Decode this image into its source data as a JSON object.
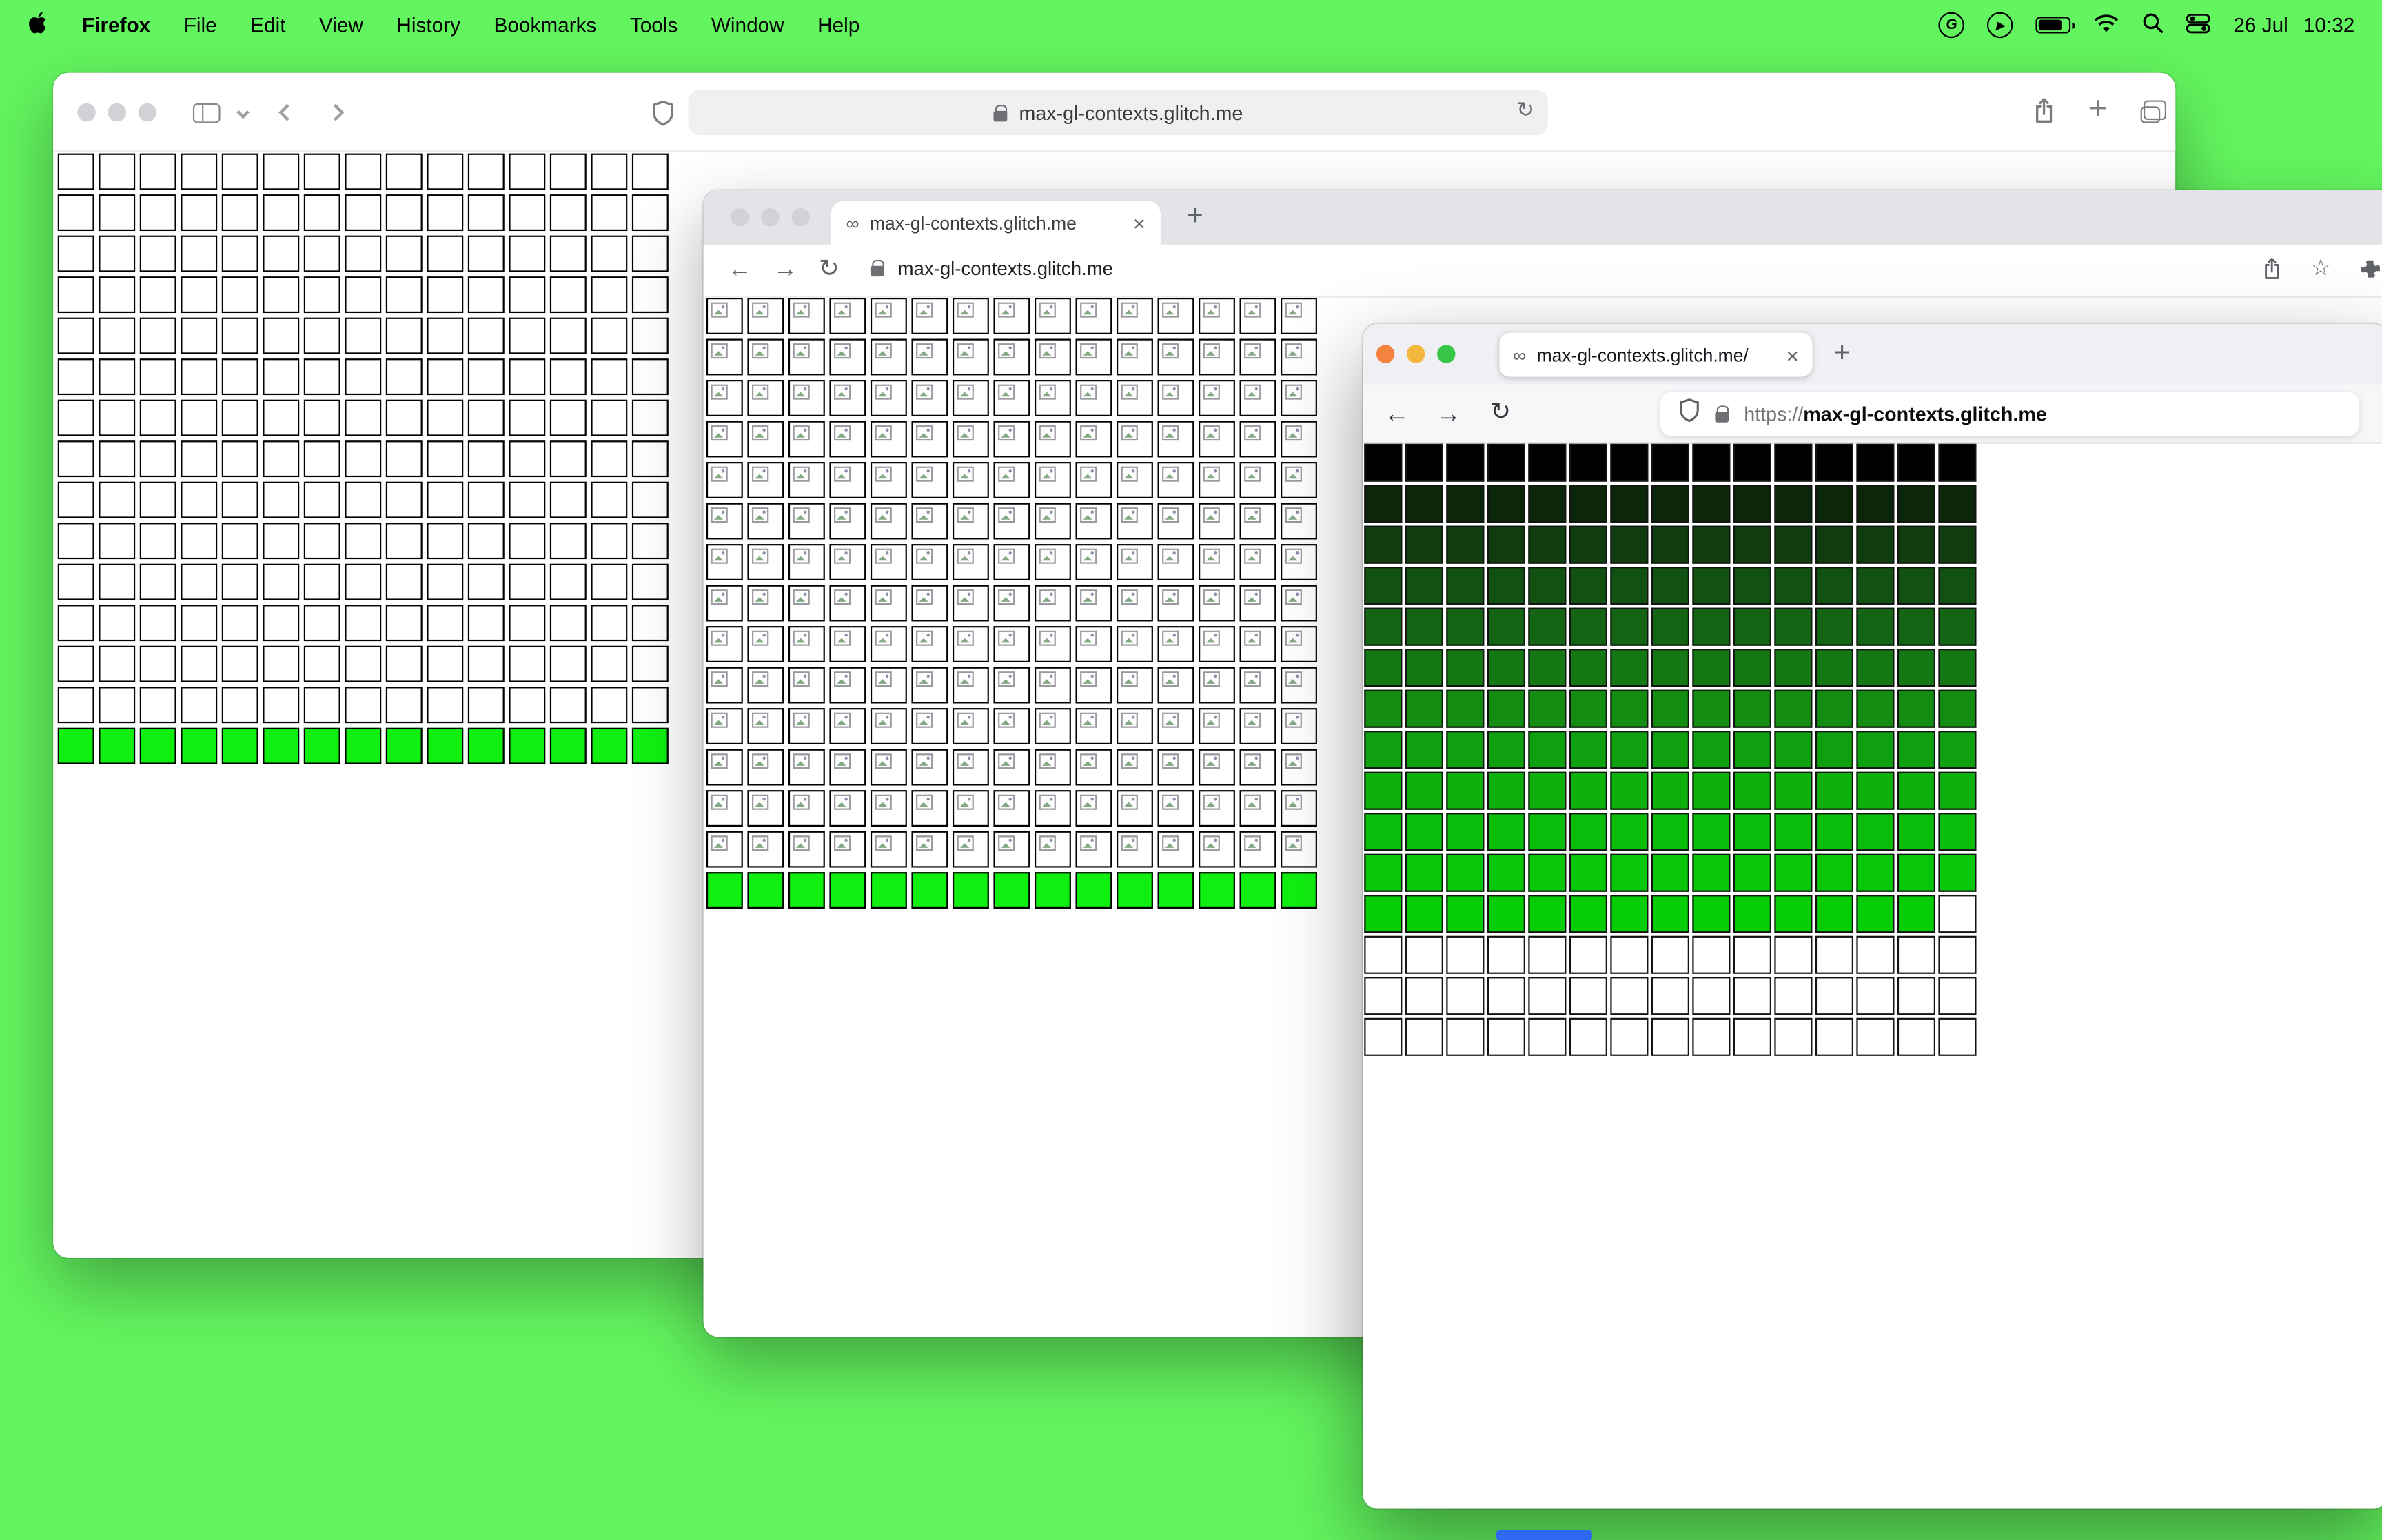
{
  "desktop": {
    "background": "#63f55f",
    "dock_accent": "#2e68f5"
  },
  "menubar": {
    "app_name": "Firefox",
    "menus": [
      "File",
      "Edit",
      "View",
      "History",
      "Bookmarks",
      "Tools",
      "Window",
      "Help"
    ],
    "g_label": "G",
    "date": "26 Jul",
    "time": "10:32"
  },
  "glyphs": {
    "infinity": "∞",
    "close": "×",
    "plus": "+",
    "back_arrow": "←",
    "forward_arrow": "→",
    "reload": "↻",
    "star": "☆",
    "play": "▶"
  },
  "windows": {
    "safari": {
      "url": "max-gl-contexts.glitch.me",
      "traffic": [
        "#d2d2d6",
        "#d2d2d6",
        "#d2d2d6"
      ],
      "grid": {
        "cols": 15,
        "rows": 15,
        "white": "#ffffff",
        "green": "#10f010",
        "green_rows": [
          14
        ]
      }
    },
    "chrome": {
      "tab_title": "max-gl-contexts.glitch.me",
      "url": "max-gl-contexts.glitch.me",
      "traffic": [
        "#d2d2d6",
        "#d2d2d6",
        "#d2d2d6"
      ],
      "grid": {
        "cols": 15,
        "rows": 15,
        "white": "#ffffff",
        "green": "#10f010",
        "green_rows": [
          14
        ],
        "broken_icon": true
      }
    },
    "firefox": {
      "tab_title": "max-gl-contexts.glitch.me/",
      "url_scheme": "https://",
      "url_host": "max-gl-contexts.glitch.me",
      "traffic": [
        "#f5823f",
        "#f5b63e",
        "#37c648"
      ],
      "grid": {
        "cols": 15,
        "rows": 15,
        "white": "#ffffff",
        "row_colors": [
          "#000000",
          "#0b2609",
          "#0f3d0e",
          "#115112",
          "#136513",
          "#147914",
          "#128d12",
          "#0fa00f",
          "#0db00d",
          "#0abd0a",
          "#08c608",
          "#06cd06",
          "#ffffff",
          "#ffffff",
          "#ffffff"
        ],
        "missing": [
          [
            11,
            14
          ]
        ]
      }
    }
  }
}
